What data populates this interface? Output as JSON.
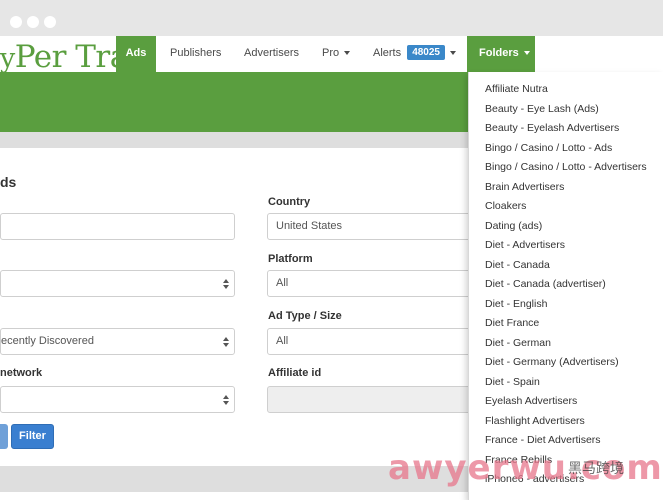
{
  "brand": {
    "text_lead": "y",
    "text_main": "Per Trail"
  },
  "nav": {
    "items": [
      {
        "label": "Ads",
        "active": true
      },
      {
        "label": "Publishers"
      },
      {
        "label": "Advertisers"
      },
      {
        "label": "Pro"
      },
      {
        "label": "Alerts"
      }
    ],
    "alerts_count": "48025",
    "folders_label": "Folders"
  },
  "form": {
    "title": "ds",
    "fields": {
      "text_input": {
        "value": ""
      },
      "select_1": {
        "value": ""
      },
      "select_sort": {
        "value": "ecently Discovered"
      },
      "select_network_label": "network",
      "select_network": {
        "value": ""
      },
      "country": {
        "label": "Country",
        "value": "United States"
      },
      "platform": {
        "label": "Platform",
        "value": "All"
      },
      "ad_type": {
        "label": "Ad Type / Size",
        "value": "All"
      },
      "affiliate_id": {
        "label": "Affiliate id",
        "value": ""
      }
    },
    "filter_label": "Filter"
  },
  "folders_menu": [
    "Affiliate Nutra",
    "Beauty - Eye Lash (Ads)",
    "Beauty - Eyelash Advertisers",
    "Bingo / Casino / Lotto - Ads",
    "Bingo / Casino / Lotto - Advertisers",
    "Brain Advertisers",
    "Cloakers",
    "Dating (ads)",
    "Diet - Advertisers",
    "Diet - Canada",
    "Diet - Canada (advertiser)",
    "Diet - English",
    "Diet France",
    "Diet - German",
    "Diet - Germany (Advertisers)",
    "Diet - Spain",
    "Eyelash Advertisers",
    "Flashlight Advertisers",
    "France - Diet Advertisers",
    "France Rebills",
    "iPhone6 - advertisers"
  ],
  "watermark": {
    "text": "awyerwu.com",
    "cn": "黑马跨境"
  },
  "colors": {
    "brand_green": "#5a9e3f",
    "badge_blue": "#3a88c9",
    "button_blue": "#3a7fd0"
  }
}
